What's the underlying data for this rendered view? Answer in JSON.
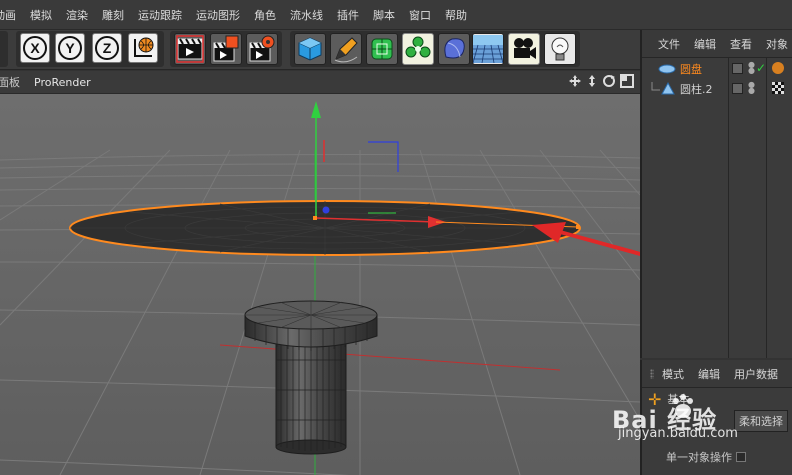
{
  "menu": {
    "items": [
      "动画",
      "模拟",
      "渲染",
      "雕刻",
      "运动跟踪",
      "运动图形",
      "角色",
      "流水线",
      "插件",
      "脚本",
      "窗口",
      "帮助"
    ]
  },
  "toolbar": {
    "axis_x": "X",
    "axis_y": "Y",
    "axis_z": "Z",
    "icons": [
      "coordinate-system-icon",
      "render-view-icon",
      "render-to-picture-viewer-icon",
      "render-settings-icon",
      "cube-icon",
      "pen-icon",
      "subdivision-surface-icon",
      "cloner-icon",
      "deformer-icon",
      "floor-icon",
      "camera-icon",
      "light-icon"
    ]
  },
  "viewport": {
    "header_left": "面板",
    "renderer": "ProRender"
  },
  "object_manager": {
    "tabs": [
      "文件",
      "编辑",
      "查看",
      "对象"
    ],
    "objects": [
      {
        "name": "圆盘",
        "selected": true,
        "color": "#ff8a1e"
      },
      {
        "name": "圆柱.2",
        "selected": false,
        "color": "#c8c8c8"
      }
    ]
  },
  "attribute_manager": {
    "tabs": [
      "模式",
      "编辑",
      "用户数据"
    ],
    "mode_label": "基本",
    "soft_select_label": "柔和选择",
    "option_label": "单一对象操作"
  },
  "watermark": {
    "brand": "Bai 经验",
    "url": "jingyan.baidu.com"
  },
  "colors": {
    "selection": "#ff8a1e",
    "axis_x": "#e03030",
    "axis_y": "#30d040",
    "axis_z": "#3040e0",
    "annotation_arrow": "#e03030"
  }
}
